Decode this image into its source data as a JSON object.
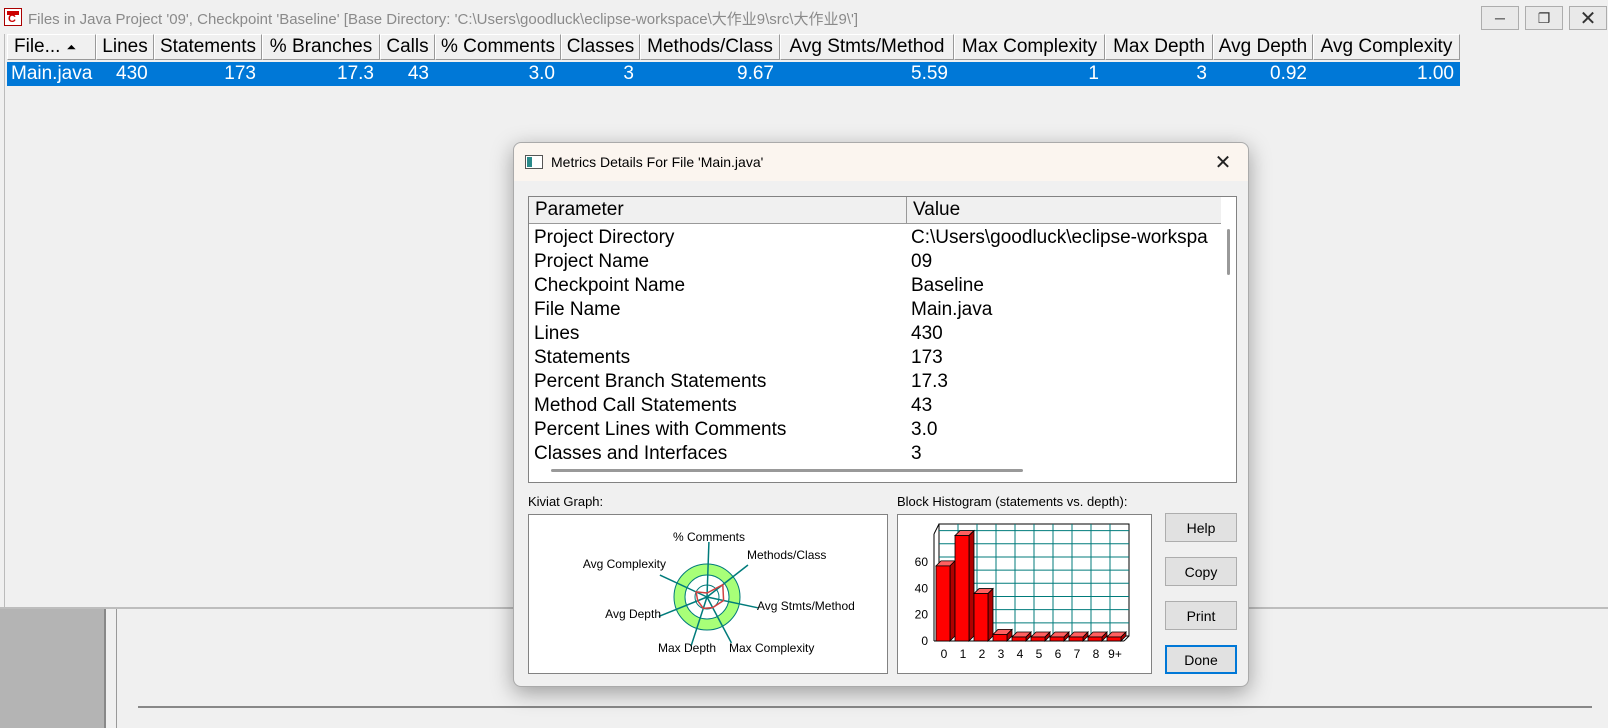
{
  "window": {
    "title": "Files in Java Project '09', Checkpoint 'Baseline'  [Base Directory: 'C:\\Users\\goodluck\\eclipse-workspace\\大作业9\\src\\大作业9\\']"
  },
  "grid": {
    "columns": [
      {
        "label": "File...",
        "width": 89
      },
      {
        "label": "Lines",
        "width": 58
      },
      {
        "label": "Statements",
        "width": 108
      },
      {
        "label": "% Branches",
        "width": 118
      },
      {
        "label": "Calls",
        "width": 55
      },
      {
        "label": "% Comments",
        "width": 126
      },
      {
        "label": "Classes",
        "width": 79
      },
      {
        "label": "Methods/Class",
        "width": 140
      },
      {
        "label": "Avg Stmts/Method",
        "width": 174
      },
      {
        "label": "Max Complexity",
        "width": 151
      },
      {
        "label": "Max Depth",
        "width": 108
      },
      {
        "label": "Avg Depth",
        "width": 100
      },
      {
        "label": "Avg Complexity",
        "width": 147
      }
    ],
    "rows": [
      [
        "Main.java",
        "430",
        "173",
        "17.3",
        "43",
        "3.0",
        "3",
        "9.67",
        "5.59",
        "1",
        "3",
        "0.92",
        "1.00"
      ]
    ]
  },
  "dialog": {
    "title": "Metrics Details For File 'Main.java'",
    "table": {
      "headers": [
        "Parameter",
        "Value"
      ],
      "rows": [
        [
          "Project Directory",
          "C:\\Users\\goodluck\\eclipse-workspa"
        ],
        [
          "Project Name",
          "09"
        ],
        [
          "Checkpoint Name",
          "Baseline"
        ],
        [
          "File Name",
          "Main.java"
        ],
        [
          "Lines",
          "430"
        ],
        [
          "Statements",
          "173"
        ],
        [
          "Percent Branch Statements",
          "17.3"
        ],
        [
          "Method Call Statements",
          "43"
        ],
        [
          "Percent Lines with Comments",
          "3.0"
        ],
        [
          "Classes and Interfaces",
          "3"
        ]
      ]
    },
    "kiviat_label": "Kiviat Graph:",
    "kiviat_axes": [
      "% Comments",
      "Methods/Class",
      "Avg Stmts/Method",
      "Max Complexity",
      "Max Depth",
      "Avg Depth",
      "Avg Complexity"
    ],
    "histogram_label": "Block Histogram (statements vs. depth):",
    "buttons": {
      "help": "Help",
      "copy": "Copy",
      "print": "Print",
      "done": "Done"
    },
    "colors": {
      "bar": "#ff0000",
      "grid": "#007b7b",
      "kiviat_fill": "#a8ff78",
      "kiviat_line": "#d04040"
    }
  },
  "chart_data": {
    "type": "bar",
    "categories": [
      "0",
      "1",
      "2",
      "3",
      "4",
      "5",
      "6",
      "7",
      "8",
      "9+"
    ],
    "values": [
      57,
      80,
      36,
      5,
      0,
      0,
      0,
      0,
      0,
      0
    ],
    "yticks": [
      "0",
      "20",
      "40",
      "60"
    ],
    "ylim": [
      0,
      85
    ],
    "grid": true
  }
}
